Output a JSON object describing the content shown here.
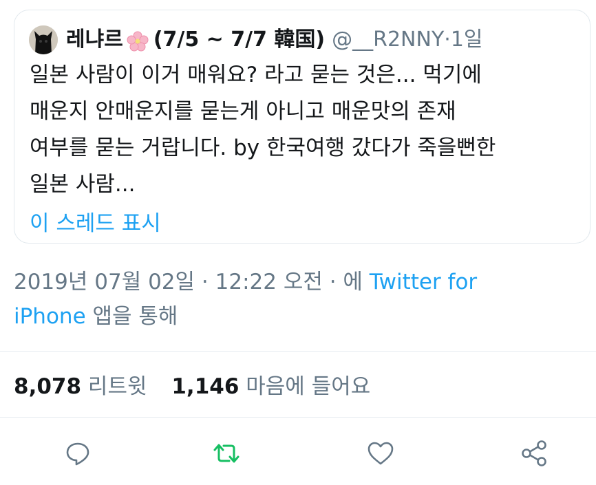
{
  "quoted_tweet": {
    "avatar_icon": "black-cat-avatar",
    "display_name": "레냐르",
    "name_emoji_icon": "cherry-blossom-icon",
    "name_suffix": "(7/5 ~ 7/7 韓国)",
    "handle": "@__R2NNY",
    "time_separator": " · ",
    "time": "1일",
    "text_lines": [
      "일본 사람이 이거 매워요? 라고 묻는 것은... 먹기에",
      "매운지 안매운지를 묻는게 아니고 매운맛의 존재",
      "여부를 묻는 거랍니다. by 한국여행 갔다가 죽을뻔한",
      "일본 사람..."
    ],
    "show_thread": "이 스레드 표시"
  },
  "meta": {
    "date": "2019년 07월 02일",
    "separator": " · ",
    "time": "12:22 오전",
    "via_prefix": "에 ",
    "source_line1": "Twitter for",
    "source_line2": "iPhone",
    "via_suffix": " 앱을 통해"
  },
  "stats": {
    "retweets_count": "8,078",
    "retweets_label": "리트윗",
    "likes_count": "1,146",
    "likes_label": "마음에 들어요"
  },
  "actions": {
    "reply_icon": "reply-icon",
    "retweet_icon": "retweet-icon",
    "like_icon": "heart-icon",
    "share_icon": "share-icon"
  },
  "colors": {
    "link": "#1da1f2",
    "secondary_text": "#657786",
    "retweet_active": "#17bf63",
    "border": "#e1e8ed"
  }
}
